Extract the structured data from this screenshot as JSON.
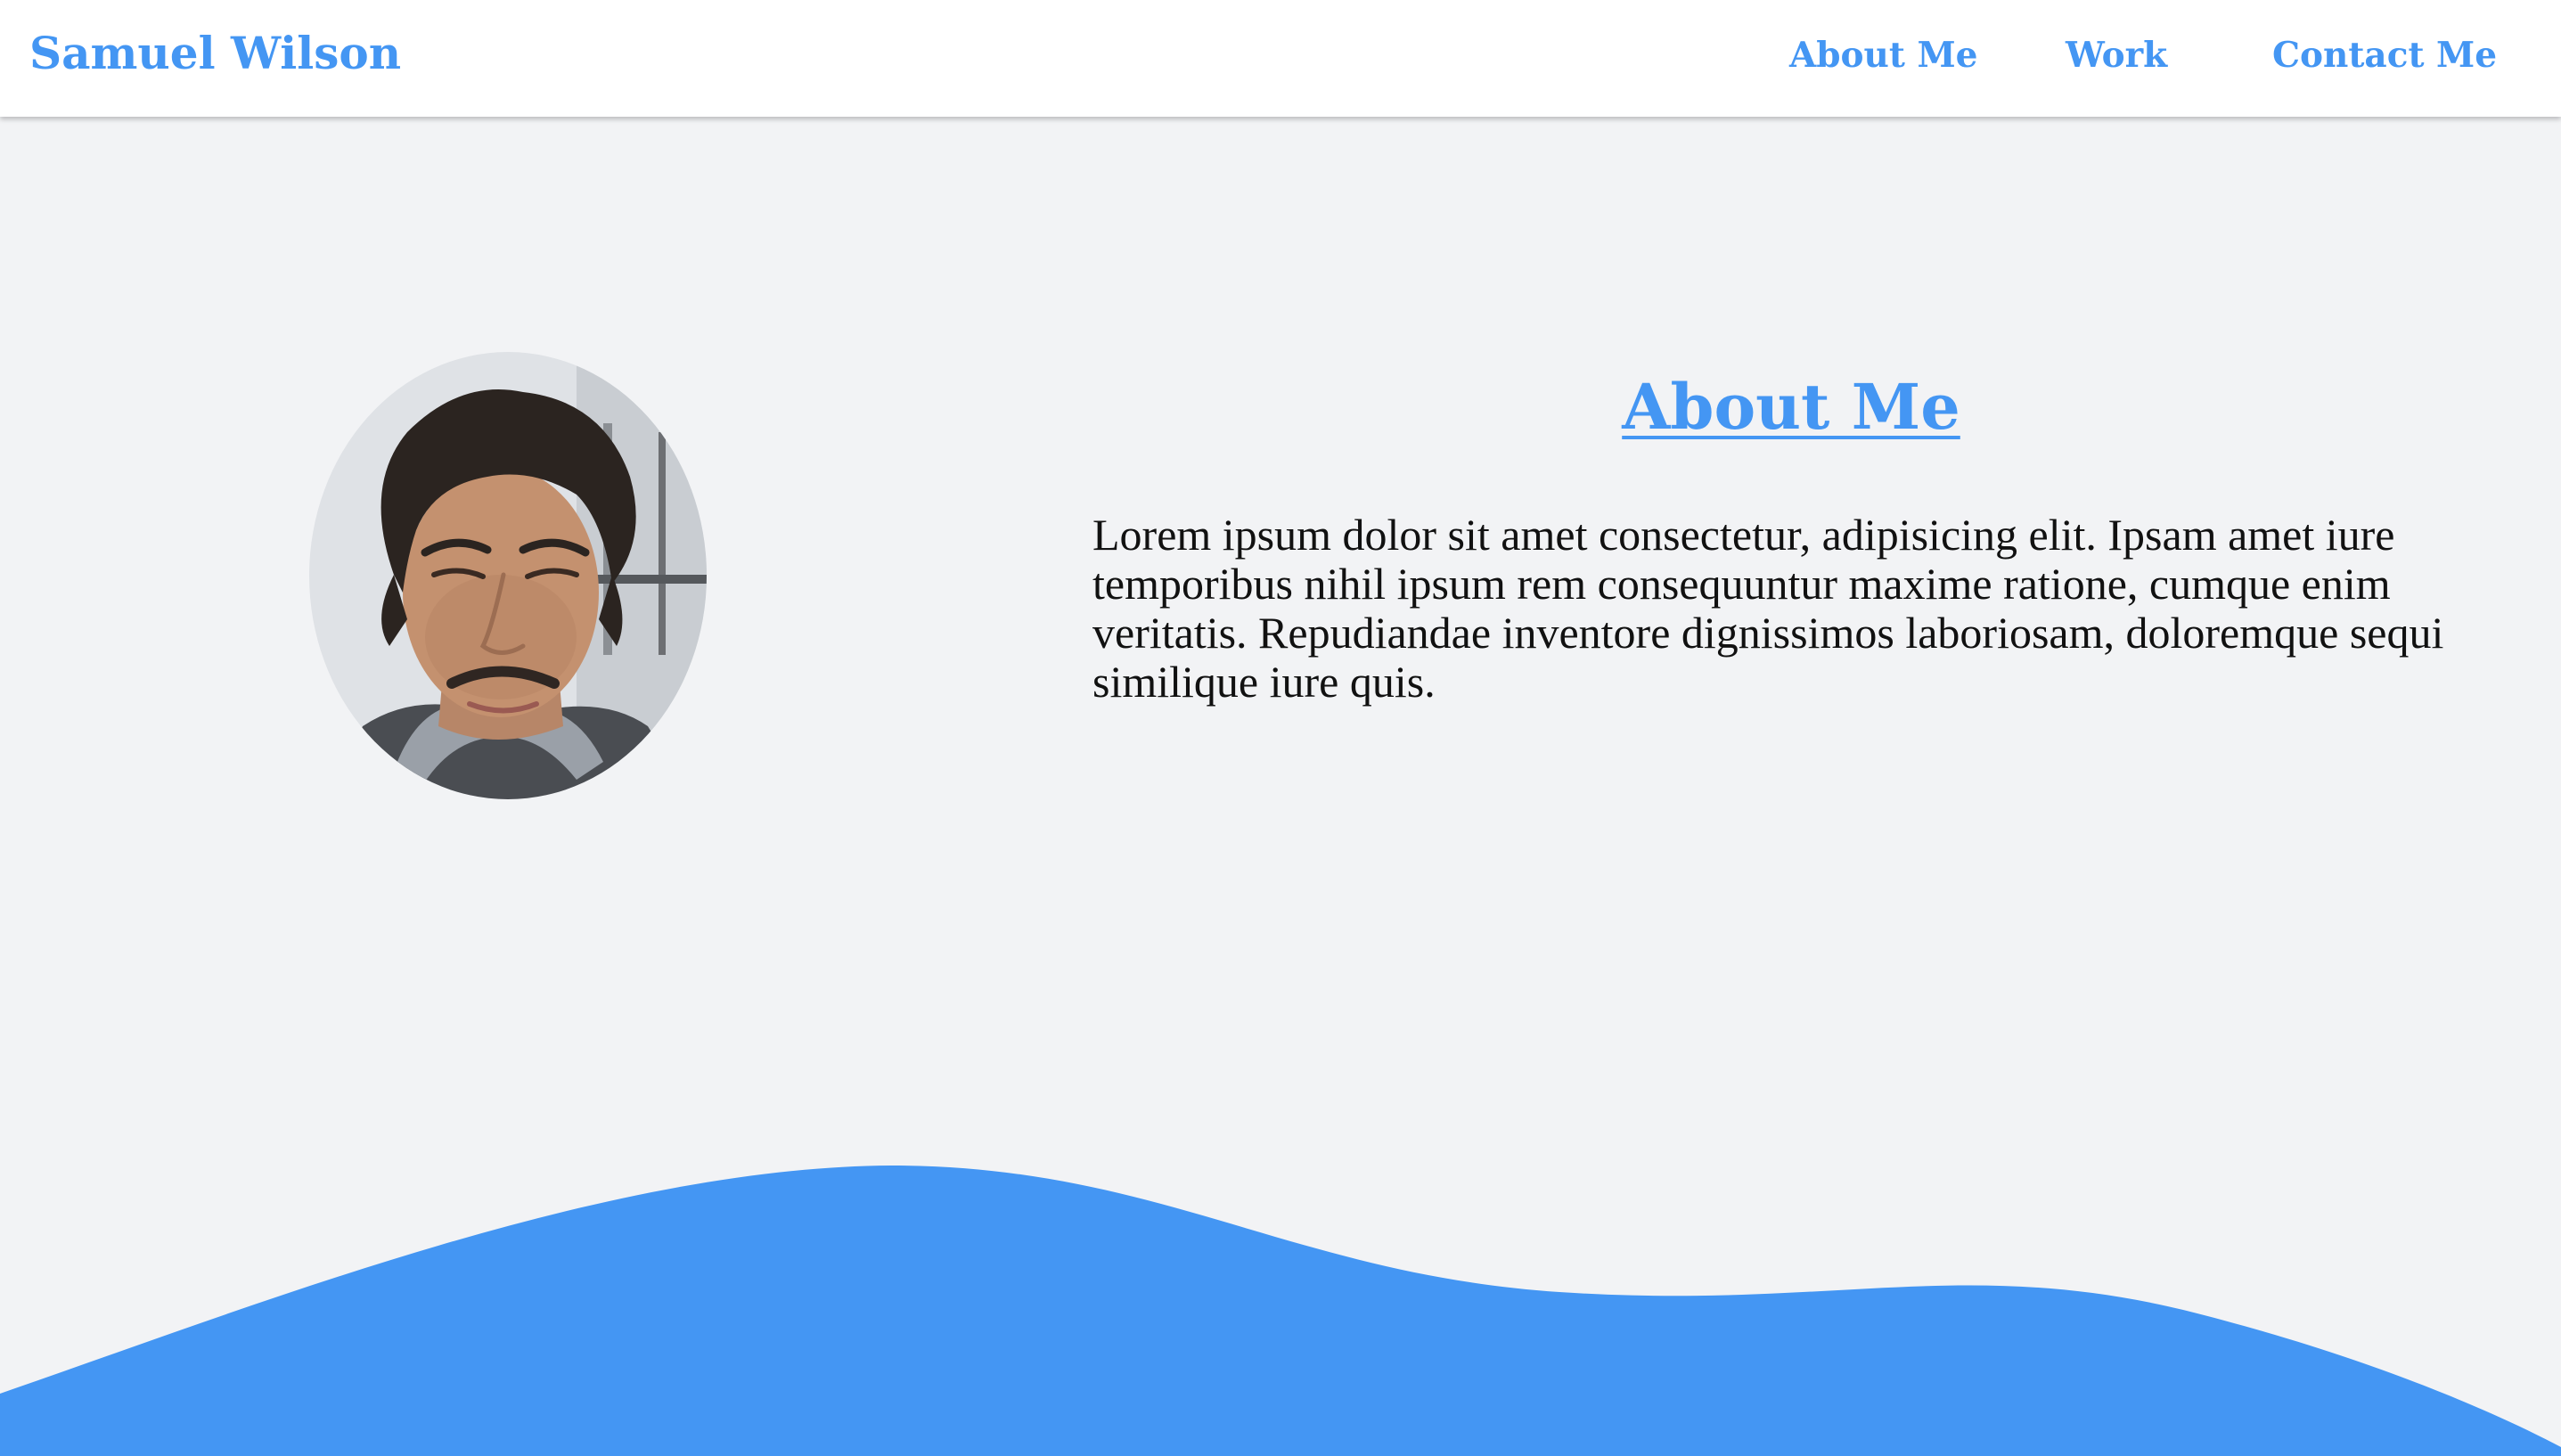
{
  "navbar": {
    "brand": "Samuel Wilson",
    "links": [
      {
        "label": "About Me"
      },
      {
        "label": "Work"
      },
      {
        "label": "Contact Me"
      }
    ]
  },
  "about": {
    "title": "About Me",
    "paragraph": "Lorem ipsum dolor sit amet consectetur, adipisicing elit. Ipsam amet iure temporibus nihil ipsum rem consequuntur maxime ratione, cumque enim veritatis. Repudiandae inventore dignissimos laboriosam, doloremque sequi similique iure quis."
  },
  "colors": {
    "accent": "#4496f3",
    "background": "#f2f3f5",
    "navbar": "#ffffff",
    "text": "#111111"
  }
}
